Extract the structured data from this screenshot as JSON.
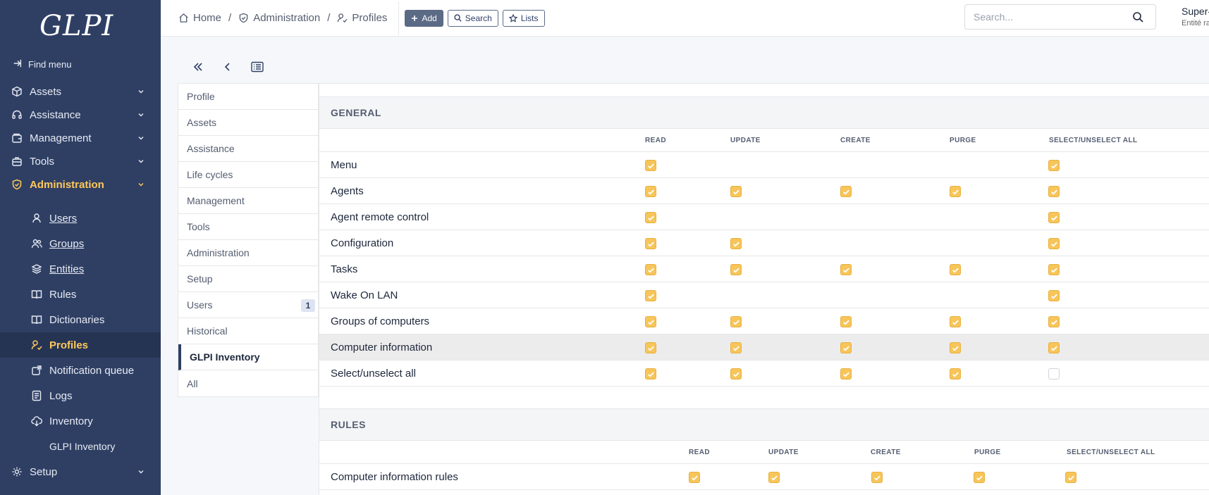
{
  "app": {
    "logo": "GLPI"
  },
  "sidebar": {
    "find_menu": "Find menu",
    "items": [
      {
        "label": "Assets",
        "icon": "box-icon"
      },
      {
        "label": "Assistance",
        "icon": "headset-icon"
      },
      {
        "label": "Management",
        "icon": "wallet-icon"
      },
      {
        "label": "Tools",
        "icon": "briefcase-icon"
      },
      {
        "label": "Administration",
        "icon": "shield-icon"
      }
    ],
    "subitems": [
      {
        "label": "Users",
        "icon": "user-icon"
      },
      {
        "label": "Groups",
        "icon": "users-icon"
      },
      {
        "label": "Entities",
        "icon": "stack-icon"
      },
      {
        "label": "Rules",
        "icon": "book-icon"
      },
      {
        "label": "Dictionaries",
        "icon": "book-icon"
      },
      {
        "label": "Profiles",
        "icon": "user-check-icon"
      },
      {
        "label": "Notification queue",
        "icon": "mail-queue-icon"
      },
      {
        "label": "Logs",
        "icon": "log-icon"
      },
      {
        "label": "Inventory",
        "icon": "cloud-download-icon"
      },
      {
        "label": "GLPI Inventory",
        "icon": ""
      }
    ],
    "setup": {
      "label": "Setup",
      "icon": "gear-icon"
    }
  },
  "breadcrumb": {
    "home": "Home",
    "admin": "Administration",
    "profiles": "Profiles"
  },
  "toolbar": {
    "add": "Add",
    "search": "Search",
    "lists": "Lists"
  },
  "global_search": {
    "placeholder": "Search..."
  },
  "user": {
    "name": "Super-Admin",
    "entity": "Entité racine"
  },
  "tabs": [
    {
      "label": "Profile"
    },
    {
      "label": "Assets"
    },
    {
      "label": "Assistance"
    },
    {
      "label": "Life cycles"
    },
    {
      "label": "Management"
    },
    {
      "label": "Tools"
    },
    {
      "label": "Administration"
    },
    {
      "label": "Setup"
    },
    {
      "label": "Users",
      "badge": "1"
    },
    {
      "label": "Historical"
    },
    {
      "label": "GLPI Inventory",
      "active": true
    },
    {
      "label": "All"
    }
  ],
  "sections": {
    "general": {
      "title": "GENERAL",
      "columns": [
        "READ",
        "UPDATE",
        "CREATE",
        "PURGE",
        "SELECT/UNSELECT ALL"
      ],
      "rows": [
        {
          "label": "Menu",
          "read": true,
          "update": null,
          "create": null,
          "purge": null,
          "all": true
        },
        {
          "label": "Agents",
          "read": true,
          "update": true,
          "create": true,
          "purge": true,
          "all": true
        },
        {
          "label": "Agent remote control",
          "read": true,
          "update": null,
          "create": null,
          "purge": null,
          "all": true
        },
        {
          "label": "Configuration",
          "read": true,
          "update": true,
          "create": null,
          "purge": null,
          "all": true
        },
        {
          "label": "Tasks",
          "read": true,
          "update": true,
          "create": true,
          "purge": true,
          "all": true
        },
        {
          "label": "Wake On LAN",
          "read": true,
          "update": null,
          "create": null,
          "purge": null,
          "all": true
        },
        {
          "label": "Groups of computers",
          "read": true,
          "update": true,
          "create": true,
          "purge": true,
          "all": true
        },
        {
          "label": "Computer information",
          "read": true,
          "update": true,
          "create": true,
          "purge": true,
          "all": true
        },
        {
          "label": "Select/unselect all",
          "read": true,
          "update": true,
          "create": true,
          "purge": true,
          "all": false
        }
      ]
    },
    "rules": {
      "title": "RULES",
      "columns": [
        "READ",
        "UPDATE",
        "CREATE",
        "PURGE",
        "SELECT/UNSELECT ALL"
      ],
      "rows": [
        {
          "label": "Computer information rules",
          "read": true,
          "update": true,
          "create": true,
          "purge": true,
          "all": true
        }
      ]
    }
  },
  "colors": {
    "sidebar": "#2f3f64",
    "accent": "#fec95c",
    "checkbox": "#f7c55a"
  }
}
